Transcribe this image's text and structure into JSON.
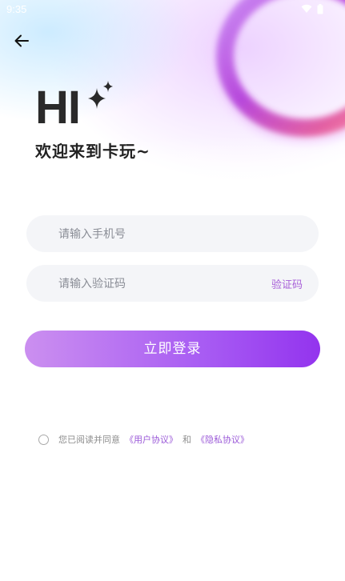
{
  "status_bar": {
    "time": "9:35",
    "icons": [
      "wifi-icon",
      "battery-icon"
    ]
  },
  "header": {
    "back_icon": "arrow-left-icon",
    "greeting": "HI",
    "sparkle_icon": "sparkle-icon",
    "welcome": "欢迎来到卡玩~"
  },
  "form": {
    "phone_placeholder": "请输入手机号",
    "phone_value": "",
    "code_placeholder": "请输入验证码",
    "code_value": "",
    "code_button": "验证码",
    "login_button": "立即登录"
  },
  "agreement": {
    "checked": false,
    "prefix": "您已阅读并同意",
    "user_agreement": "《用户协议》",
    "and": "和",
    "privacy_agreement": "《隐私协议》"
  },
  "colors": {
    "accent": "#9b5ad8",
    "button_start": "#cb8ff0",
    "button_end": "#9334ee",
    "field_bg": "#f4f5f8",
    "title": "#222222"
  }
}
